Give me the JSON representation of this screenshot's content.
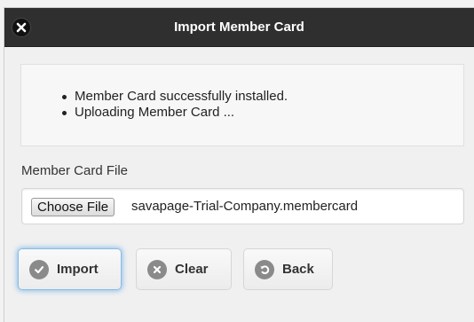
{
  "dialog": {
    "title": "Import Member Card"
  },
  "status": {
    "messages": [
      "Member Card successfully installed.",
      "Uploading Member Card ..."
    ]
  },
  "file": {
    "label": "Member Card File",
    "choose_button": "Choose File",
    "selected_file": "savapage-Trial-Company.membercard"
  },
  "actions": {
    "import_label": "Import",
    "clear_label": "Clear",
    "back_label": "Back"
  },
  "icons": {
    "close": "close-icon",
    "import": "check-circle-icon",
    "clear": "x-circle-icon",
    "back": "undo-circle-icon"
  },
  "colors": {
    "titlebar": "#2f2f2f",
    "focus_glow": "#3898ec"
  }
}
